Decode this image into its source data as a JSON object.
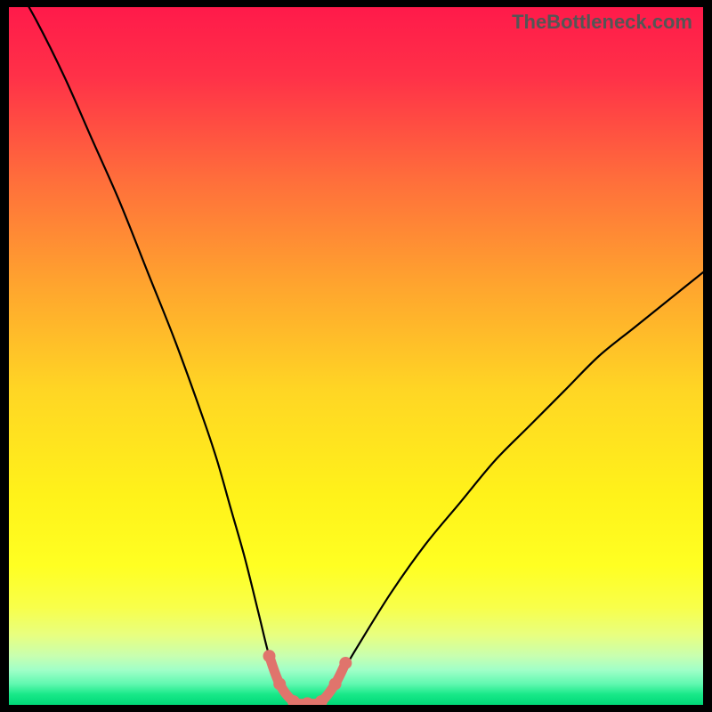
{
  "watermark": "TheBottleneck.com",
  "chart_data": {
    "type": "line",
    "title": "",
    "xlabel": "",
    "ylabel": "",
    "xlim": [
      0,
      100
    ],
    "ylim": [
      0,
      100
    ],
    "grid": false,
    "legend": false,
    "background_gradient": {
      "stops": [
        {
          "offset": 0.0,
          "color": "#ff1a4a"
        },
        {
          "offset": 0.1,
          "color": "#ff3148"
        },
        {
          "offset": 0.25,
          "color": "#ff6f3b"
        },
        {
          "offset": 0.4,
          "color": "#ffa52e"
        },
        {
          "offset": 0.55,
          "color": "#ffd624"
        },
        {
          "offset": 0.7,
          "color": "#fff21a"
        },
        {
          "offset": 0.8,
          "color": "#ffff22"
        },
        {
          "offset": 0.86,
          "color": "#f8ff4a"
        },
        {
          "offset": 0.9,
          "color": "#e8ff80"
        },
        {
          "offset": 0.93,
          "color": "#c8ffb0"
        },
        {
          "offset": 0.95,
          "color": "#a0ffc8"
        },
        {
          "offset": 0.97,
          "color": "#60f8b0"
        },
        {
          "offset": 0.985,
          "color": "#18e888"
        },
        {
          "offset": 1.0,
          "color": "#00d878"
        }
      ]
    },
    "series": [
      {
        "name": "bottleneck-curve",
        "color": "#000000",
        "x": [
          0,
          4,
          8,
          12,
          16,
          20,
          24,
          28,
          30,
          32,
          34,
          36,
          37.5,
          39,
          41,
          43,
          45,
          47,
          50,
          55,
          60,
          65,
          70,
          75,
          80,
          85,
          90,
          95,
          100
        ],
        "y": [
          105,
          98,
          90,
          81,
          72,
          62,
          52,
          41,
          35,
          28,
          21,
          13,
          7,
          3,
          0.5,
          0.2,
          0.5,
          3,
          8,
          16,
          23,
          29,
          35,
          40,
          45,
          50,
          54,
          58,
          62
        ]
      }
    ],
    "highlight": {
      "name": "sweet-spot",
      "color": "#e0746c",
      "points_x": [
        37.5,
        39,
        41,
        43,
        45,
        47,
        48.5
      ],
      "points_y": [
        7,
        3,
        0.5,
        0.2,
        0.5,
        3,
        6
      ]
    }
  }
}
